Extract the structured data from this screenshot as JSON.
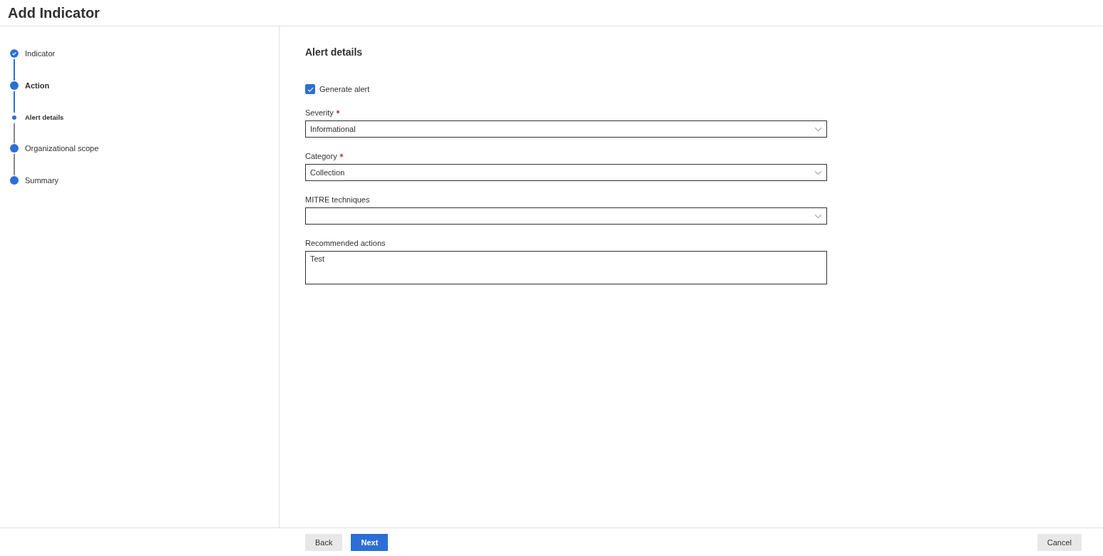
{
  "window": {
    "title": "Add Indicator"
  },
  "steps": [
    {
      "label": "Indicator",
      "kind": "step",
      "completed": true,
      "current": false
    },
    {
      "label": "Action",
      "kind": "step",
      "completed": false,
      "current": true
    },
    {
      "label": "Alert details",
      "kind": "substep",
      "current": true
    },
    {
      "label": "Organizational scope",
      "kind": "step",
      "completed": false,
      "current": false
    },
    {
      "label": "Summary",
      "kind": "step",
      "completed": false,
      "current": false
    }
  ],
  "section_title": "Alert details",
  "generate_alert": {
    "label": "Generate alert",
    "checked": true
  },
  "fields": [
    {
      "label": "Severity",
      "required": true,
      "kind": "select",
      "value": "Informational"
    },
    {
      "label": "Category",
      "required": true,
      "kind": "select",
      "value": "Collection"
    },
    {
      "label": "MITRE techniques",
      "kind": "select"
    },
    {
      "label": "Recommended actions",
      "kind": "textarea",
      "value": "Test"
    }
  ],
  "footer": {
    "back": "Back",
    "next": "Next",
    "cancel": "Cancel"
  }
}
